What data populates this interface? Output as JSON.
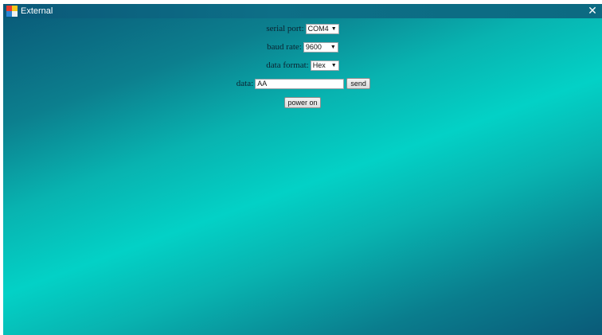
{
  "window": {
    "title": "External",
    "close_glyph": "✕"
  },
  "icons": {
    "app": "app-logo-icon",
    "close": "close-icon",
    "dropdown": "dropdown-arrow-icon"
  },
  "form": {
    "serial_port": {
      "label": "serial port:",
      "value": "COM4"
    },
    "baud_rate": {
      "label": "baud rate:",
      "value": "9600"
    },
    "data_format": {
      "label": "data format:",
      "value": "Hex"
    },
    "data": {
      "label": "data:",
      "value": "AA"
    },
    "send_label": "send",
    "power_label": "power on",
    "dropdown_arrow": "▼"
  },
  "colors": {
    "title_bar": "#0c6a82",
    "background_light": "#03d1c6",
    "background_dark": "#0a5877"
  }
}
